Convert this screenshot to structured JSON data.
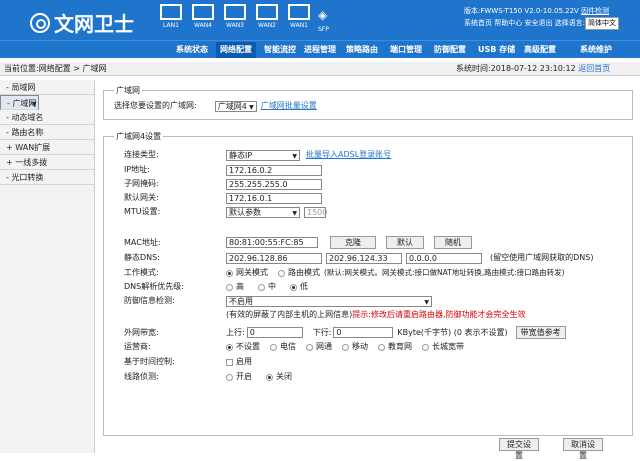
{
  "header": {
    "brand": "文网卫士",
    "ports": [
      "LAN1",
      "WAN4",
      "WAN3",
      "WAN2",
      "WAN1"
    ],
    "sfp": "SFP",
    "version": "版本:FWWS-T150 V2.0-10.05.22V",
    "upgrade": "固件检测",
    "links": "系统首页 帮助中心 安全退出",
    "lang_label": "选择语言:",
    "lang": "简体中文"
  },
  "nav": {
    "items": [
      "系统状态",
      "网络配置",
      "智能流控",
      "进程管理",
      "策略路由",
      "端口管理",
      "防御配置",
      "USB 存储",
      "高级配置",
      "系统维护"
    ],
    "active": 1
  },
  "breadcrumb": {
    "path": "当前位置:网络配置 > 广域网",
    "time": "系统时间:2018-07-12 23:10:12",
    "home": "返回首页"
  },
  "sidebar": {
    "items": [
      "局域网",
      "广域网",
      "动态域名",
      "路由名称",
      "WAN扩展",
      "一线多拨",
      "光口转换"
    ],
    "active": 1,
    "prefix": [
      "-",
      "-",
      "-",
      "-",
      "+",
      "+",
      "-"
    ]
  },
  "sec1": {
    "legend": "广域网",
    "label": "选择您要设置的广域网:",
    "value": "广域网4",
    "link": "广域网批量设置"
  },
  "sec2": {
    "legend": "广域网4设置",
    "conn_label": "连接类型:",
    "conn_value": "静态IP",
    "conn_link": "批量导入ADSL登录账号",
    "ip_label": "IP地址:",
    "ip": "172.16.0.2",
    "mask_label": "子网掩码:",
    "mask": "255.255.255.0",
    "gw_label": "默认网关:",
    "gw": "172.16.0.1",
    "mtu_label": "MTU设置:",
    "mtu_sel": "默认参数",
    "mtu_val": "1500",
    "mac_label": "MAC地址:",
    "mac": "80:81:00:55:FC:85",
    "mac_btns": [
      "克隆",
      "默认",
      "随机"
    ],
    "dns_label": "静态DNS:",
    "dns": [
      "202.96.128.86",
      "202.96.124.33",
      "0.0.0.0"
    ],
    "dns_note": "(留空使用广域网获取的DNS)",
    "mode_label": "工作模式:",
    "mode_opts": [
      "网关模式",
      "路由模式"
    ],
    "mode_note": "(默认:网关模式。网关模式:接口做NAT地址转换,路由模式:接口路由转发)",
    "dnsp_label": "DNS解析优先级:",
    "dnsp_opts": [
      "高",
      "中",
      "低"
    ],
    "def_label": "防御信息检测:",
    "def_value": "不启用",
    "def_note1": "(有效的屏蔽了内部主机的上网信息)",
    "def_note2": "提示:修改后请重启路由器,防御功能才会完全生效",
    "bw_label": "外网带宽:",
    "up_label": "上行:",
    "up": "0",
    "down_label": "下行:",
    "down": "0",
    "bw_unit": "KByte(千字节) (0 表示不设置)",
    "bw_btn": "带宽值参考",
    "isp_label": "运营商:",
    "isp_opts": [
      "不设置",
      "电信",
      "网通",
      "移动",
      "教育网",
      "长城宽带"
    ],
    "time_label": "基于时间控制:",
    "time_opt": "启用",
    "det_label": "线路侦测:",
    "det_opts": [
      "开启",
      "关闭"
    ]
  },
  "buttons": {
    "submit": "提交设置",
    "cancel": "取消设置"
  }
}
